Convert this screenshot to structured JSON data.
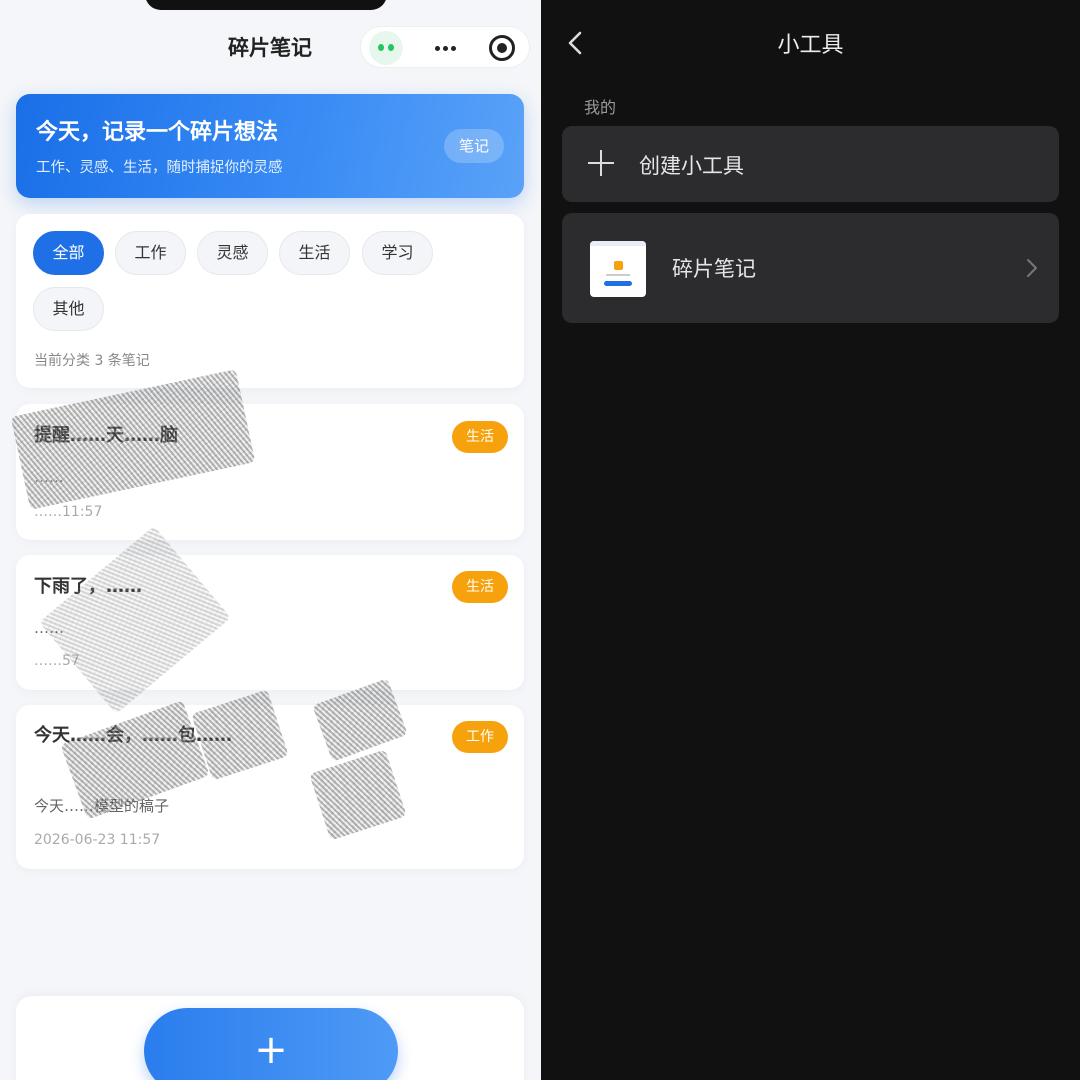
{
  "left": {
    "app_title": "碎片笔记",
    "hero": {
      "title": "今天，记录一个碎片想法",
      "subtitle": "工作、灵感、生活，随时捕捉你的灵感",
      "badge": "笔记"
    },
    "filters": {
      "chips": [
        {
          "label": "全部",
          "active": true
        },
        {
          "label": "工作",
          "active": false
        },
        {
          "label": "灵感",
          "active": false
        },
        {
          "label": "生活",
          "active": false
        },
        {
          "label": "学习",
          "active": false
        },
        {
          "label": "其他",
          "active": false
        }
      ],
      "count_text": "当前分类 3 条笔记"
    },
    "notes": [
      {
        "title": "提醒……天……脑",
        "body": "……",
        "time": "……11:57",
        "tag": "生活"
      },
      {
        "title": "下雨了，……",
        "body": "……",
        "time": "……57",
        "tag": "生活"
      },
      {
        "title": "今天……会，……包……",
        "body": "今天……模型的稿子",
        "time": "2026-06-23 11:57",
        "tag": "工作"
      }
    ],
    "add_button": "+",
    "colors": {
      "accent": "#1f6fe6",
      "tag": "#f6a20c",
      "online": "#22c55e"
    }
  },
  "right": {
    "title": "小工具",
    "section": "我的",
    "create_label": "创建小工具",
    "app_label": "碎片笔记"
  },
  "icons": [
    "back-chevron-icon",
    "plus-icon",
    "chevron-right-icon",
    "more-icon",
    "close-target-icon",
    "assistant-eyes-icon"
  ]
}
